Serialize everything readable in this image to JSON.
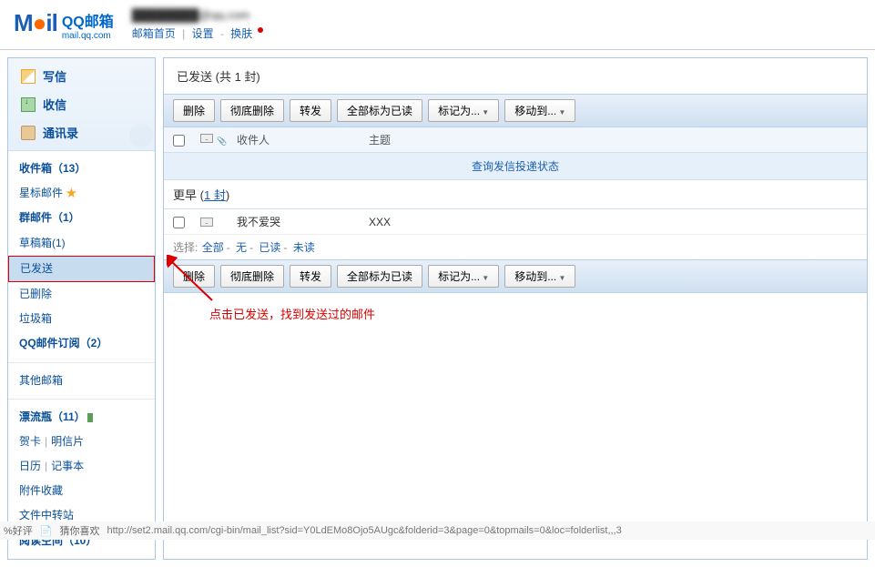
{
  "header": {
    "logo_cn": "QQ邮箱",
    "logo_url": "mail.qq.com",
    "user_email": "████████@qq.com",
    "nav_home": "邮箱首页",
    "nav_settings": "设置",
    "nav_theme": "换肤"
  },
  "sidebar": {
    "main": {
      "compose": "写信",
      "receive": "收信",
      "contacts": "通讯录"
    },
    "folders1": {
      "inbox": "收件箱（13）",
      "starred": "星标邮件",
      "group": "群邮件（1）",
      "drafts": "草稿箱(1)",
      "sent": "已发送",
      "deleted": "已删除",
      "spam": "垃圾箱",
      "subscribe": "QQ邮件订阅（2）"
    },
    "folders2": {
      "other": "其他邮箱"
    },
    "folders3": {
      "drift": "漂流瓶（11）",
      "greeting_a": "贺卡",
      "greeting_b": "明信片",
      "calendar_a": "日历",
      "calendar_b": "记事本",
      "attach": "附件收藏",
      "transfer": "文件中转站",
      "read": "阅读空间（10）"
    }
  },
  "main": {
    "title": "已发送",
    "title_count": "(共 1 封)",
    "toolbar": {
      "delete": "删除",
      "delete_forever": "彻底删除",
      "forward": "转发",
      "mark_all_read": "全部标为已读",
      "mark_as": "标记为...",
      "move_to": "移动到..."
    },
    "columns": {
      "from": "收件人",
      "subject": "主题"
    },
    "status_link": "查询发信投递状态",
    "section": {
      "label": "更早",
      "count": "1 封"
    },
    "mail": {
      "from": "我不爱哭",
      "subject": "XXX"
    },
    "select": {
      "label": "选择:",
      "all": "全部",
      "none": "无",
      "read": "已读",
      "unread": "未读"
    }
  },
  "annotation": "点击已发送，找到发送过的邮件",
  "footer": {
    "rating": "%好评",
    "like": "猜你喜欢",
    "url": "http://set2.mail.qq.com/cgi-bin/mail_list?sid=Y0LdEMo8Ojo5AUgc&folderid=3&page=0&topmails=0&loc=folderlist,,,3"
  }
}
